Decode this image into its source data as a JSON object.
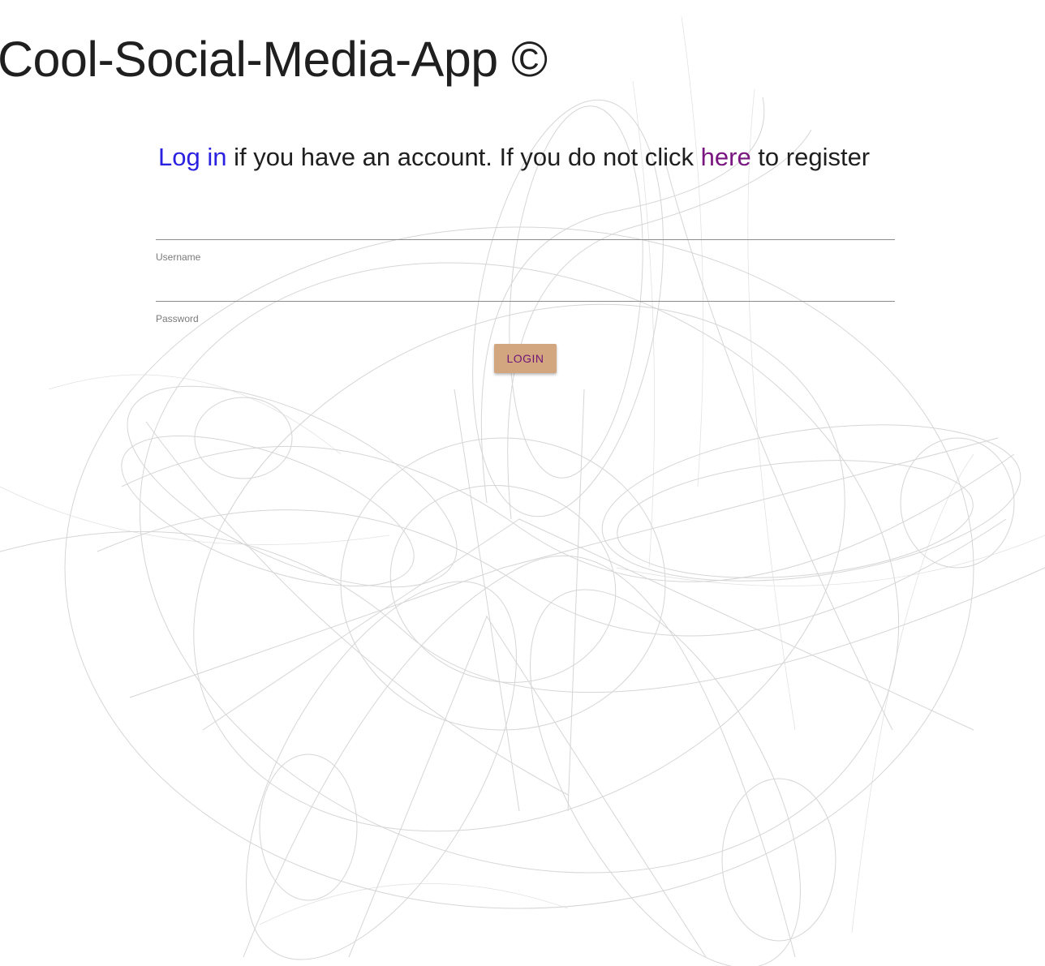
{
  "header": {
    "title": "Cool-Social-Media-App ©"
  },
  "intro": {
    "login_link": "Log in",
    "middle_text": " if you have an account. If you do not click ",
    "register_link": "here",
    "end_text": " to register"
  },
  "form": {
    "username_label": "Username",
    "username_value": "",
    "password_label": "Password",
    "password_value": "",
    "login_button": "LOGIN"
  },
  "colors": {
    "login_link": "#2a22e0",
    "register_link": "#7a1680",
    "button_bg": "#d2a67f",
    "button_text": "#6e1477"
  }
}
